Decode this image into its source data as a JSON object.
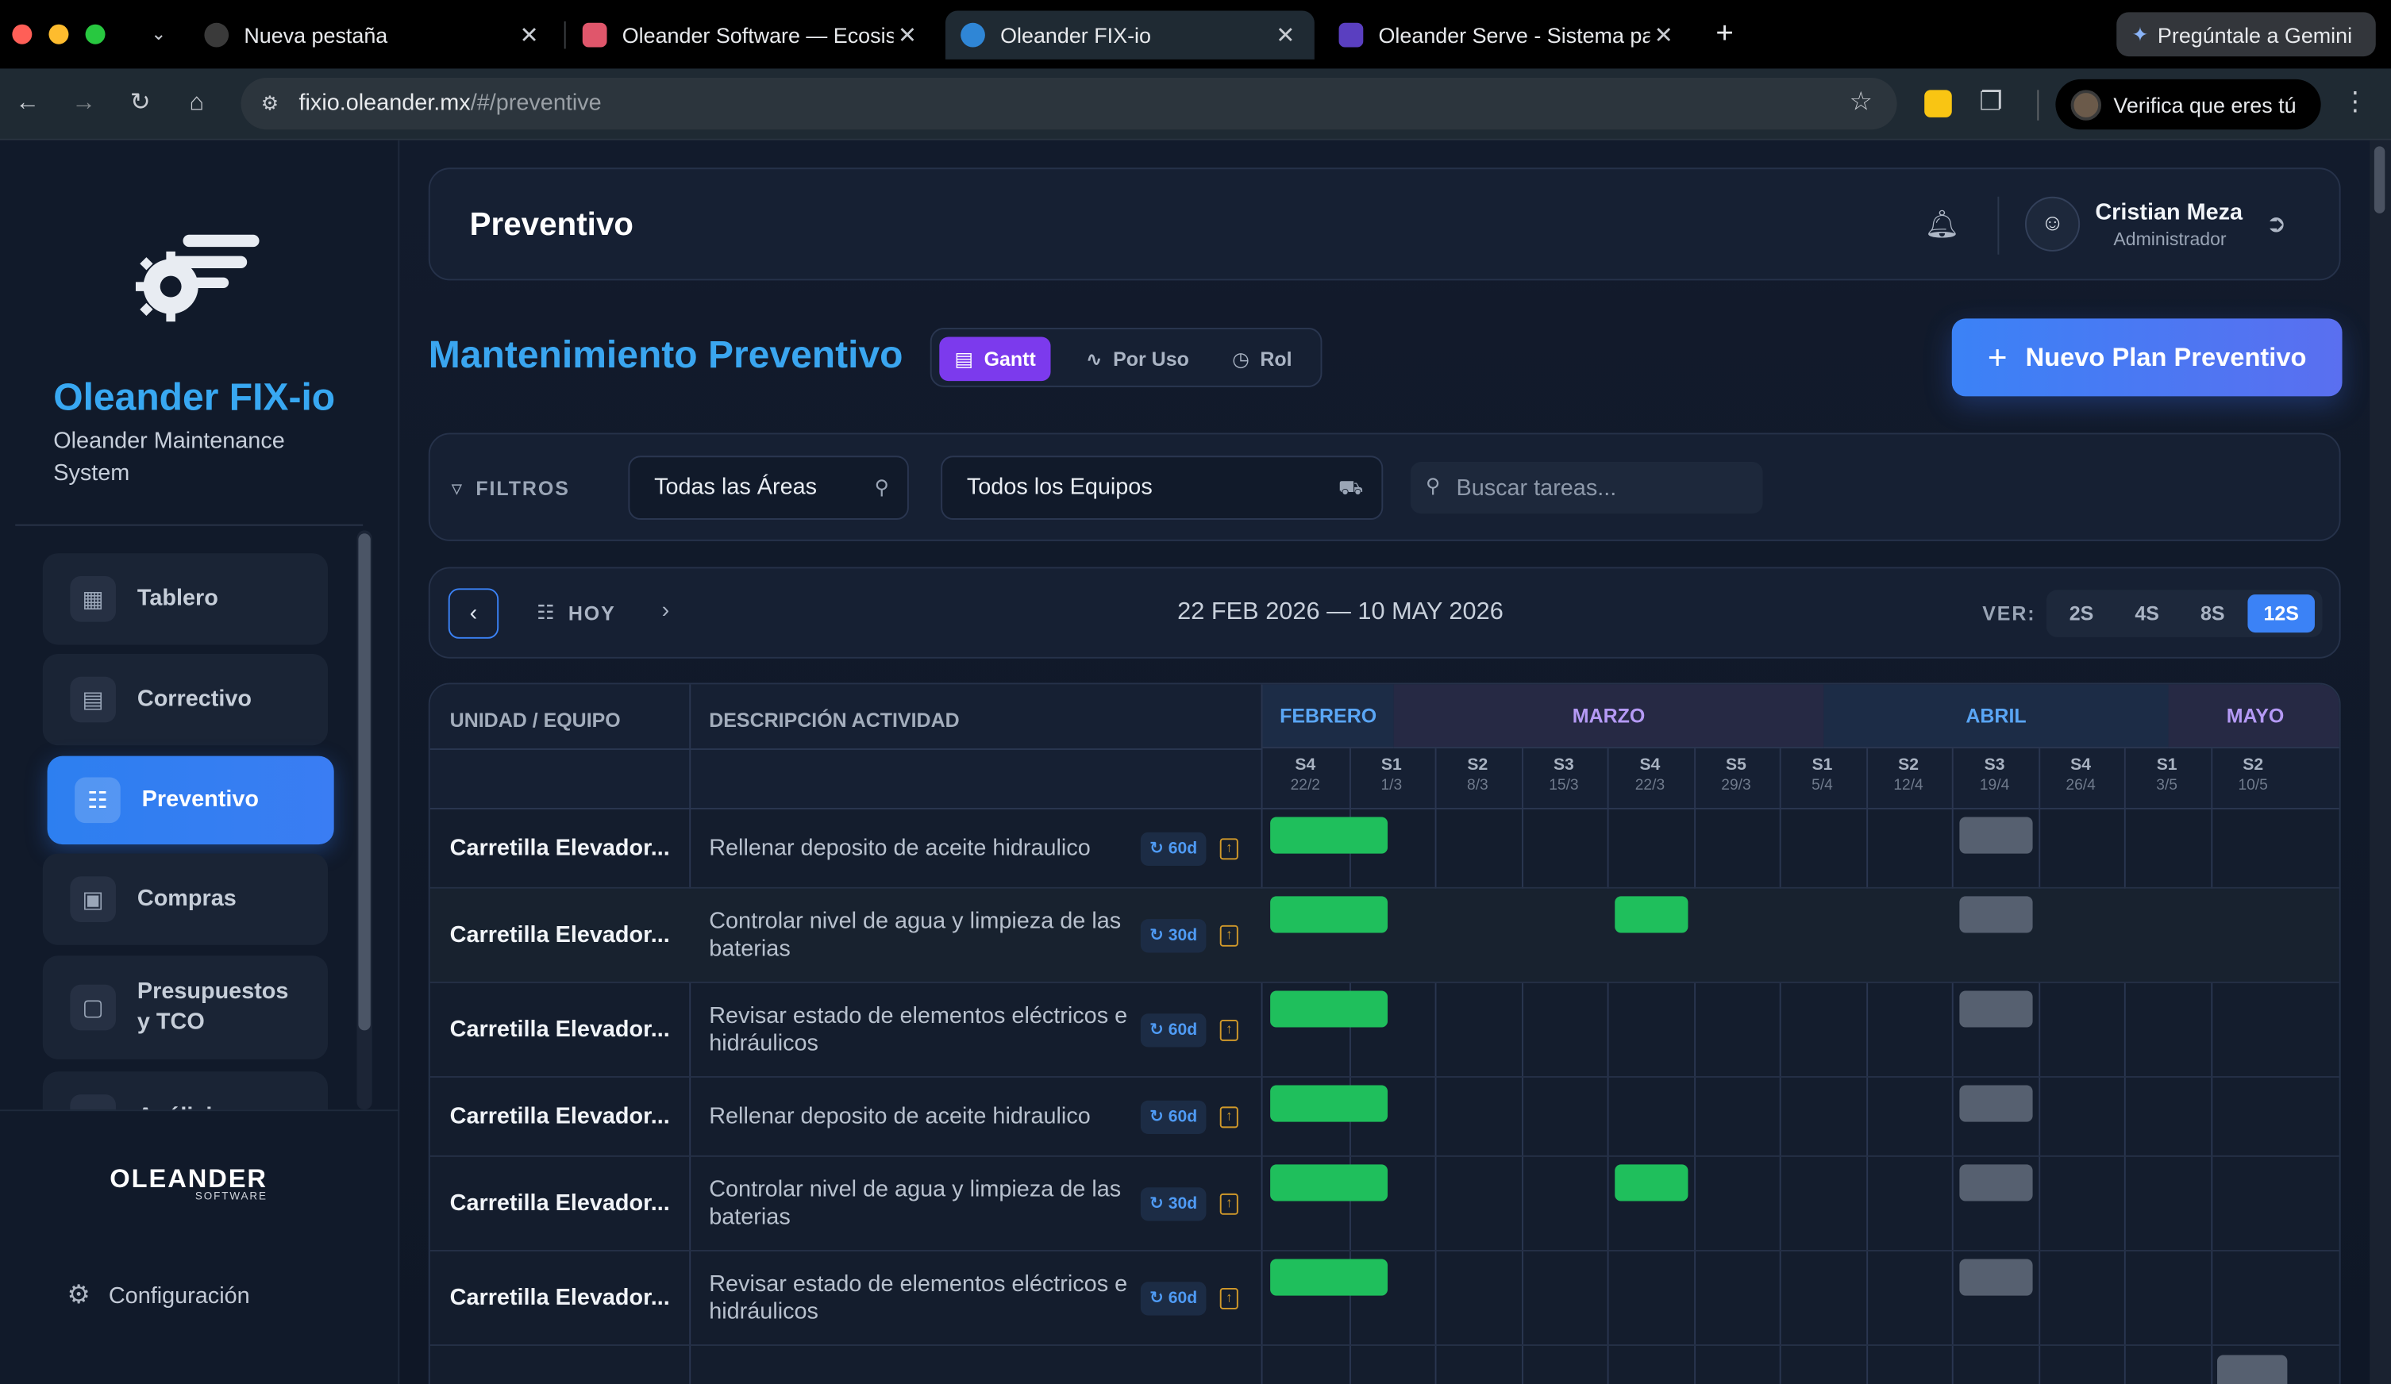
{
  "browser": {
    "tabs": [
      {
        "title": "Nueva pestaña"
      },
      {
        "title": "Oleander Software — Ecosistema"
      },
      {
        "title": "Oleander FIX-io"
      },
      {
        "title": "Oleander Serve - Sistema para"
      }
    ],
    "gemini_label": "Pregúntale a Gemini",
    "url_host": "fixio.oleander.mx",
    "url_path": "/#/preventive",
    "verify_label": "Verifica que eres tú"
  },
  "sidebar": {
    "brand": "Oleander FIX-io",
    "subtitle": "Oleander Maintenance System",
    "items": [
      {
        "label": "Tablero",
        "icon": "dashboard-icon"
      },
      {
        "label": "Correctivo",
        "icon": "document-icon"
      },
      {
        "label": "Preventivo",
        "icon": "calendar-icon"
      },
      {
        "label": "Compras",
        "icon": "shopping-bag-icon"
      },
      {
        "label": "Presupuestos y TCO",
        "icon": "wallet-icon"
      },
      {
        "label": "Análisis",
        "icon": "folder-icon"
      }
    ],
    "footer_logo": "OLEANDER",
    "footer_logo_sub": "SOFTWARE",
    "config_label": "Configuración"
  },
  "header": {
    "title": "Preventivo",
    "user_name": "Cristian Meza",
    "user_role": "Administrador"
  },
  "page": {
    "section_title": "Mantenimiento Preventivo",
    "view_tabs": [
      "Gantt",
      "Por Uso",
      "Rol"
    ],
    "new_plan_label": "Nuevo Plan Preventivo"
  },
  "filters": {
    "label": "FILTROS",
    "area": "Todas las Áreas",
    "equipment": "Todos los Equipos",
    "search_placeholder": "Buscar tareas..."
  },
  "datebar": {
    "today_label": "HOY",
    "range": "22 FEB 2026 — 10 MAY 2026",
    "ver_label": "VER:",
    "zoom_options": [
      "2S",
      "4S",
      "8S",
      "12S"
    ],
    "zoom_selected": "12S"
  },
  "gantt": {
    "col_unit": "UNIDAD / EQUIPO",
    "col_desc": "DESCRIPCIÓN ACTIVIDAD",
    "months": [
      "FEBRERO",
      "MARZO",
      "ABRIL",
      "MAYO"
    ],
    "weeks": [
      {
        "w": "S4",
        "d": "22/2"
      },
      {
        "w": "S1",
        "d": "1/3"
      },
      {
        "w": "S2",
        "d": "8/3"
      },
      {
        "w": "S3",
        "d": "15/3"
      },
      {
        "w": "S4",
        "d": "22/3"
      },
      {
        "w": "S5",
        "d": "29/3"
      },
      {
        "w": "S1",
        "d": "5/4"
      },
      {
        "w": "S2",
        "d": "12/4"
      },
      {
        "w": "S3",
        "d": "19/4"
      },
      {
        "w": "S4",
        "d": "26/4"
      },
      {
        "w": "S1",
        "d": "3/5"
      },
      {
        "w": "S2",
        "d": "10/5"
      }
    ],
    "rows": [
      {
        "unit": "Carretilla Elevador...",
        "desc": "Rellenar deposito de aceite hidraulico",
        "freq": "60d"
      },
      {
        "unit": "Carretilla Elevador...",
        "desc": "Controlar nivel de agua y limpieza de las baterias",
        "freq": "30d"
      },
      {
        "unit": "Carretilla Elevador...",
        "desc": "Revisar estado de elementos eléctricos e hidráulicos",
        "freq": "60d"
      },
      {
        "unit": "Carretilla Elevador...",
        "desc": "Rellenar deposito de aceite hidraulico",
        "freq": "60d"
      },
      {
        "unit": "Carretilla Elevador...",
        "desc": "Controlar nivel de agua y limpieza de las baterias",
        "freq": "30d"
      },
      {
        "unit": "Carretilla Elevador...",
        "desc": "Revisar estado de elementos eléctricos e hidráulicos",
        "freq": "60d"
      }
    ],
    "colors": {
      "done": "#1fbf5c",
      "planned": "#566070"
    }
  }
}
